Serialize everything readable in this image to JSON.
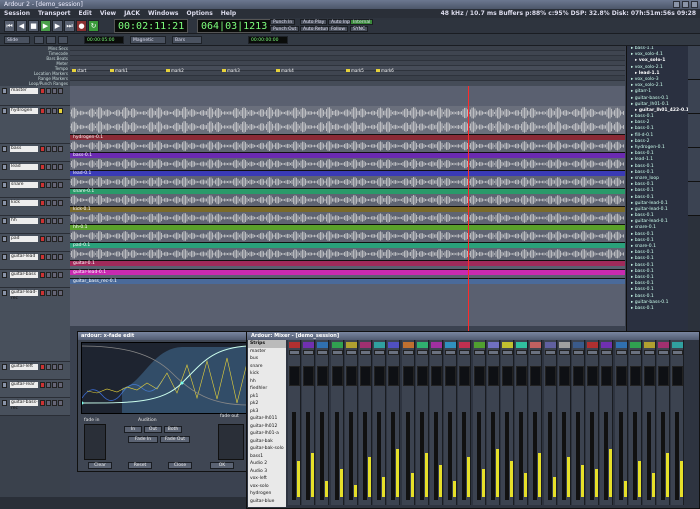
{
  "window_title": "Ardour 2 - [demo_session]",
  "menubar": {
    "items": [
      "Session",
      "Transport",
      "Edit",
      "View",
      "JACK",
      "Windows",
      "Options",
      "Help"
    ],
    "status": "48 kHz / 10.7 ms  Buffers p:88% c:95%  DSP: 32.8%  Disk: 07h:51m:56s 09:28"
  },
  "transport": {
    "primary_clock": "00:02:11:21",
    "secondary_clock": "064|03|1213",
    "punch_in_label": "Punch In",
    "punch_out_label": "Punch Out",
    "auto_play_label": "Auto Play",
    "auto_input_label": "Auto Input",
    "auto_return_label": "Auto Return",
    "follow_label": "Follow",
    "int_label": "Internal",
    "sync_label": "SYNC"
  },
  "toolbar2": {
    "edit_mode": "Slide",
    "snap": "Magnetic",
    "grid": "Bars",
    "nudge_clock": "00:00:05:00",
    "zoom_clock": "00:00:00:00"
  },
  "ruler_labels": [
    "Mins:Secs",
    "Timecode",
    "Bars:Beats",
    "Meter",
    "Tempo",
    "Location Markers",
    "Range Markers",
    "Loop/Punch Ranges"
  ],
  "markers": [
    "start",
    "mark1",
    "mark2",
    "mark3",
    "mark4",
    "mark5",
    "mark6"
  ],
  "tracks": [
    {
      "name": "master"
    },
    {
      "name": "hydrogen"
    },
    {
      "name": "bass"
    },
    {
      "name": "lead"
    },
    {
      "name": "snare"
    },
    {
      "name": "kick"
    },
    {
      "name": "hh"
    },
    {
      "name": "pad"
    },
    {
      "name": "guitar-lead"
    },
    {
      "name": "guitar-bass"
    },
    {
      "name": "guitar-lead-rec"
    },
    {
      "name": "guitar-left"
    },
    {
      "name": "guitar-rear"
    },
    {
      "name": "guitar-bass-rec"
    }
  ],
  "regions": [
    {
      "label": "hydrogen-0.1",
      "color": "#8a2a36"
    },
    {
      "label": "bass-0.1",
      "color": "#6a2ab0"
    },
    {
      "label": "lead-0.1",
      "color": "#3a3ab6"
    },
    {
      "label": "snare-0.1",
      "color": "#2a9a6a"
    },
    {
      "label": "kick-0.1",
      "color": "#7a6a2a"
    },
    {
      "label": "hh-0.1",
      "color": "#5aa02a"
    },
    {
      "label": "pad-0.1",
      "color": "#2aa07a"
    },
    {
      "label": "guitar-0.1",
      "color": "#a02a5a"
    },
    {
      "label": "guitar-lead-0.1",
      "color": "#c82ab0"
    },
    {
      "label": "guitar_bass_rec-0.1",
      "color": "#4a6a9a"
    }
  ],
  "region_list": [
    "bass-1.1",
    "vox_solo-4.1",
    "vox_solo-1",
    "vox_solo-2.1",
    "lead-1.1",
    "vox_solo-3",
    "vox_solo-2.1",
    "gitarr-1",
    "guitar-bass-0.1",
    "guitar_lh01-0.1",
    "guitar_lh01_422-0.1",
    "bass-0.1",
    "bass-2",
    "bass-0.1",
    "fill-d-0.1",
    "bass-2",
    "hydrogen-0.1",
    "bass-0.1",
    "lead-1.1",
    "bass-0.1",
    "bass-0.1",
    "snare_loop",
    "bass-0.1",
    "bass-0.1",
    "bass-0.1",
    "guitar-lead-0.1",
    "guitar-lead-0.1",
    "bass-0.1",
    "guitar-lead-0.1",
    "snare-0.1",
    "bass-0.1",
    "bass-0.1",
    "snare-0.1",
    "bass-0.1",
    "bass-0.1",
    "bass-0.1",
    "bass-0.1",
    "bass-0.1",
    "bass-0.1",
    "bass-0.1",
    "bass-0.1",
    "guitar-bass-0.1",
    "bass-0.1"
  ],
  "xfade": {
    "title": "ardour: x-fade edit",
    "fade_in": "Fade In",
    "fade_out": "Fade Out",
    "audition": "Audition",
    "in_label": "In",
    "out_label": "Out",
    "both_label": "Both",
    "apply": "Apply",
    "clear": "Clear",
    "reset": "Reset",
    "close": "Close",
    "ok": "OK",
    "fade_in_label": "fade in",
    "fade_out_label": "fade out"
  },
  "mixer": {
    "title": "Ardour: Mixer - [demo_session]",
    "strips_header": "Strips",
    "strip_names": [
      "master",
      "bus",
      "snare",
      "kick",
      "hh",
      "fiedhler",
      "pk1",
      "pk2",
      "pk3",
      "guitar-lh011",
      "guitar-lh012",
      "guitar-lh01-a",
      "guitar-bak",
      "guitar-bak-solo",
      "bass1",
      "Audio 2",
      "Audio 3",
      "vox-left",
      "vox-solo",
      "hydrogen",
      "guitar-blue"
    ],
    "strip_colors": [
      "#b03030",
      "#7030b0",
      "#3070b0",
      "#30a050",
      "#b0a030",
      "#a03070",
      "#30a0a0",
      "#5050c0",
      "#c07030",
      "#30b070",
      "#a030a0",
      "#3090c0",
      "#c03050",
      "#50a030",
      "#7070c0",
      "#c0c030",
      "#30c0a0",
      "#c06060",
      "#6060a0",
      "#a0a0a0",
      "#3a5a8a"
    ]
  }
}
